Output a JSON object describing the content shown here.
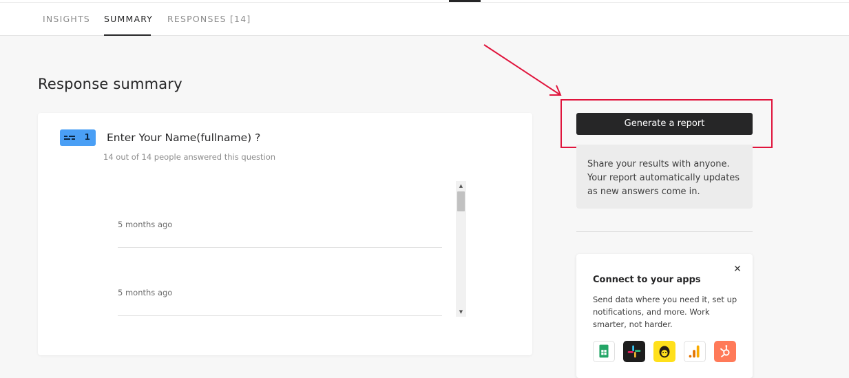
{
  "tabs": [
    {
      "label": "INSIGHTS",
      "active": false
    },
    {
      "label": "SUMMARY",
      "active": true
    },
    {
      "label": "RESPONSES [14]",
      "active": false
    }
  ],
  "page": {
    "title": "Response summary"
  },
  "question": {
    "number": "1",
    "type_icon": "short-text-icon",
    "title": "Enter Your Name(fullname) ?",
    "answered_text": "14 out of 14 people answered this question",
    "responses": [
      {
        "time": "5 months ago"
      },
      {
        "time": "5 months ago"
      }
    ]
  },
  "report": {
    "button_label": "Generate a report",
    "info_text": "Share your results with anyone. Your report automatically updates as new answers come in."
  },
  "apps": {
    "title": "Connect to your apps",
    "description": "Send data where you need it, set up notifications, and more. Work smarter, not harder.",
    "close_icon": "close-icon",
    "icons": [
      "google-sheets-icon",
      "slack-icon",
      "mailchimp-icon",
      "google-analytics-icon",
      "hubspot-icon"
    ]
  },
  "colors": {
    "accent_dark": "#262627",
    "badge_blue": "#4a9ff5",
    "annotation_red": "#e0143c",
    "background": "#f7f7f7"
  }
}
